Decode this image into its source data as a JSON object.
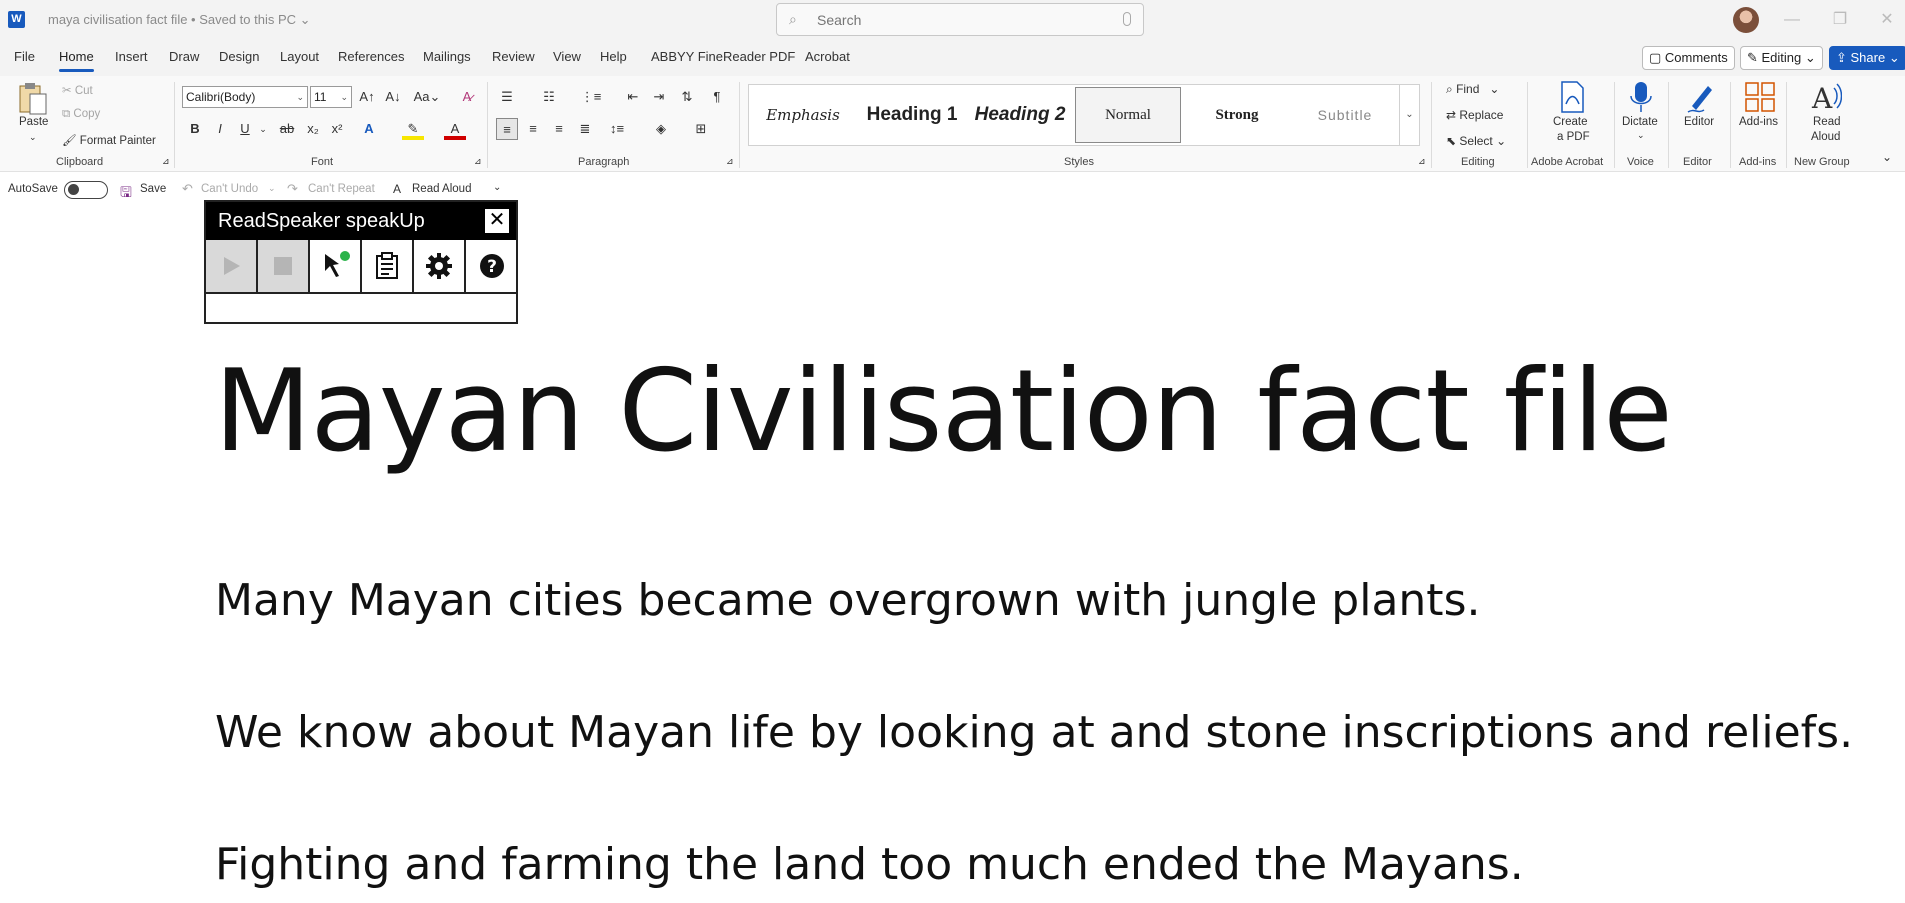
{
  "window": {
    "app_letter": "W",
    "doc_title": "maya civilisation fact file • Saved to this PC ⌄",
    "search_placeholder": "Search",
    "minimize": "—",
    "maximize": "❐",
    "close": "✕"
  },
  "tabs": [
    "File",
    "Home",
    "Insert",
    "Draw",
    "Design",
    "Layout",
    "References",
    "Mailings",
    "Review",
    "View",
    "Help",
    "ABBYY FineReader PDF",
    "Acrobat"
  ],
  "active_tab": "Home",
  "top_right": {
    "comments": "Comments",
    "editing": "Editing",
    "share": "Share"
  },
  "ribbon": {
    "clipboard": {
      "paste": "Paste",
      "cut": "Cut",
      "copy": "Copy",
      "format_painter": "Format Painter",
      "label": "Clipboard"
    },
    "font": {
      "name": "Calibri(Body)",
      "size": "11",
      "label": "Font"
    },
    "paragraph": {
      "label": "Paragraph"
    },
    "styles": {
      "items": [
        "Emphasis",
        "Heading 1",
        "Heading 2",
        "Normal",
        "Strong",
        "Subtitle"
      ],
      "label": "Styles"
    },
    "editing": {
      "find": "Find",
      "replace": "Replace",
      "select": "Select",
      "label": "Editing"
    },
    "acrobat": {
      "create_pdf_1": "Create",
      "create_pdf_2": "a PDF",
      "label": "Adobe Acrobat"
    },
    "voice": {
      "dictate": "Dictate",
      "label": "Voice"
    },
    "editor": {
      "editor": "Editor",
      "label": "Editor"
    },
    "addins": {
      "addins": "Add-ins",
      "label": "Add-ins"
    },
    "newgroup": {
      "read_aloud_1": "Read",
      "read_aloud_2": "Aloud",
      "label": "New Group"
    }
  },
  "qat": {
    "autosave": "AutoSave",
    "save": "Save",
    "undo": "Can't Undo",
    "repeat": "Can't Repeat",
    "read_aloud": "Read Aloud"
  },
  "readspeaker": {
    "title": "ReadSpeaker speakUp",
    "close": "✕"
  },
  "document": {
    "title": "Mayan Civilisation fact file",
    "paragraphs": [
      "Many Mayan cities became overgrown with jungle plants.",
      "We know about Mayan life by looking at and stone inscriptions and reliefs.",
      "Fighting and farming the land too much ended the Mayans."
    ]
  }
}
